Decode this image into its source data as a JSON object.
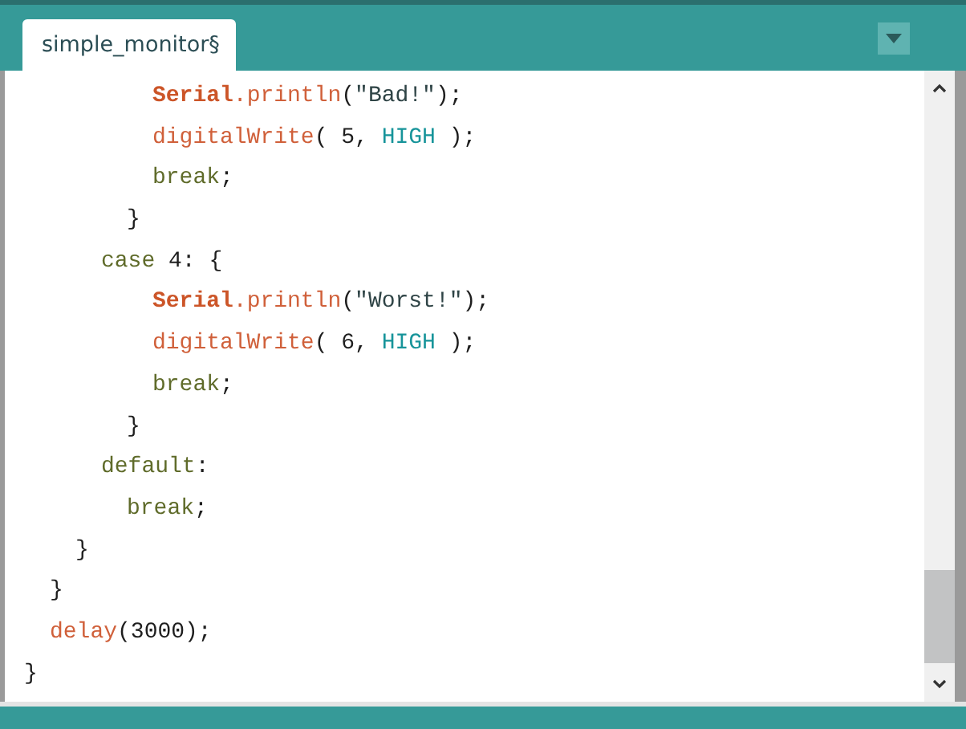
{
  "tabs": [
    {
      "label": "simple_monitor",
      "modified_mark": "§",
      "selected": true
    }
  ],
  "code": [
    {
      "children": [
        {
          "children": [
            {
              "children": [
                {
                  "children": [
                    {
                      "children": [
                        {
                          "tokens": [
                            {
                              "text": "Serial",
                              "kind": "class"
                            },
                            {
                              "text": ".println",
                              "kind": "function"
                            },
                            {
                              "text": "(",
                              "kind": "plain"
                            },
                            {
                              "text": "\"Bad!\"",
                              "kind": "string"
                            },
                            {
                              "text": ");",
                              "kind": "plain"
                            }
                          ]
                        },
                        {
                          "tokens": [
                            {
                              "text": "digitalWrite",
                              "kind": "function"
                            },
                            {
                              "text": "( 5, ",
                              "kind": "plain"
                            },
                            {
                              "text": "HIGH",
                              "kind": "constant"
                            },
                            {
                              "text": " );",
                              "kind": "plain"
                            }
                          ]
                        },
                        {
                          "tokens": [
                            {
                              "text": "break",
                              "kind": "keyword"
                            },
                            {
                              "text": ";",
                              "kind": "plain"
                            }
                          ]
                        }
                      ]
                    },
                    {
                      "tokens": [
                        {
                          "text": "}",
                          "kind": "plain"
                        }
                      ]
                    }
                  ]
                },
                {
                  "tokens": [
                    {
                      "text": "case",
                      "kind": "keyword"
                    },
                    {
                      "text": " 4: {",
                      "kind": "plain"
                    }
                  ],
                  "children": [
                    {
                      "children": [
                        {
                          "tokens": [
                            {
                              "text": "Serial",
                              "kind": "class"
                            },
                            {
                              "text": ".println",
                              "kind": "function"
                            },
                            {
                              "text": "(",
                              "kind": "plain"
                            },
                            {
                              "text": "\"Worst!\"",
                              "kind": "string"
                            },
                            {
                              "text": ");",
                              "kind": "plain"
                            }
                          ]
                        },
                        {
                          "tokens": [
                            {
                              "text": "digitalWrite",
                              "kind": "function"
                            },
                            {
                              "text": "( 6, ",
                              "kind": "plain"
                            },
                            {
                              "text": "HIGH",
                              "kind": "constant"
                            },
                            {
                              "text": " );",
                              "kind": "plain"
                            }
                          ]
                        },
                        {
                          "tokens": [
                            {
                              "text": "break",
                              "kind": "keyword"
                            },
                            {
                              "text": ";",
                              "kind": "plain"
                            }
                          ]
                        }
                      ]
                    },
                    {
                      "tokens": [
                        {
                          "text": "}",
                          "kind": "plain"
                        }
                      ]
                    }
                  ]
                },
                {
                  "tokens": [
                    {
                      "text": "default",
                      "kind": "keyword"
                    },
                    {
                      "text": ":",
                      "kind": "plain"
                    }
                  ],
                  "children": [
                    {
                      "tokens": [
                        {
                          "text": "break",
                          "kind": "keyword"
                        },
                        {
                          "text": ";",
                          "kind": "plain"
                        }
                      ]
                    }
                  ]
                }
              ]
            },
            {
              "tokens": [
                {
                  "text": "}",
                  "kind": "plain"
                }
              ]
            }
          ]
        },
        {
          "tokens": [
            {
              "text": "}",
              "kind": "plain"
            }
          ]
        },
        {
          "tokens": [
            {
              "text": "delay",
              "kind": "function"
            },
            {
              "text": "(3000);",
              "kind": "plain"
            }
          ]
        }
      ]
    },
    {
      "tokens": [
        {
          "text": "}",
          "kind": "plain"
        }
      ]
    }
  ]
}
